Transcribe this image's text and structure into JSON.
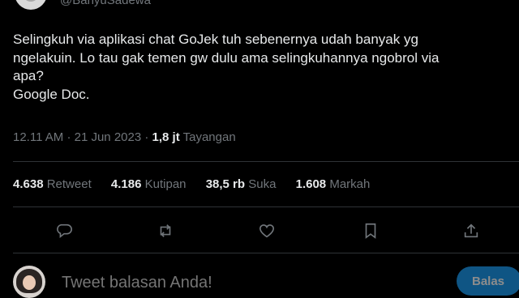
{
  "author": {
    "handle": "@BanyuSadewa"
  },
  "tweet": {
    "lines": [
      "Selingkuh via aplikasi chat GoJek tuh sebenernya udah banyak yg",
      "ngelakuin. Lo tau gak temen gw dulu ama selingkuhannya ngobrol via",
      "apa?",
      "Google Doc."
    ],
    "time": "12.11 AM",
    "separator": "·",
    "date": "21 Jun 2023",
    "views_count": "1,8 jt",
    "views_label": "Tayangan"
  },
  "stats": [
    {
      "value": "4.638",
      "label": "Retweet"
    },
    {
      "value": "4.186",
      "label": "Kutipan"
    },
    {
      "value": "38,5 rb",
      "label": "Suka"
    },
    {
      "value": "1.608",
      "label": "Markah"
    }
  ],
  "actions": {
    "reply_icon": "reply-icon",
    "retweet_icon": "retweet-icon",
    "like_icon": "heart-icon",
    "bookmark_icon": "bookmark-icon",
    "share_icon": "share-icon"
  },
  "reply_box": {
    "placeholder": "Tweet balasan Anda!",
    "button_label": "Balas"
  },
  "colors": {
    "background": "#000000",
    "text": "#e7e9ea",
    "muted": "#71767b",
    "divider": "#2f3336",
    "accent": "#1d9bf0"
  }
}
